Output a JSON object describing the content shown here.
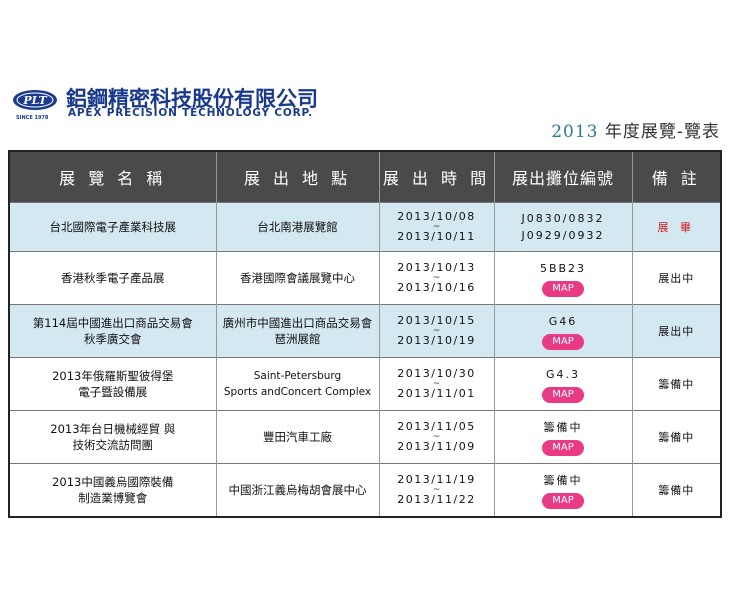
{
  "company": {
    "badge": "PLT",
    "since": "SINCE 1978",
    "name_cn": "鋁鋼精密科技股份有限公司",
    "name_en": "APEX PRECISION TECHNOLOGY CORP."
  },
  "doc_title": {
    "year": "2013",
    "text": "年度展覽-覽表"
  },
  "table": {
    "headers": [
      "展 覽 名 稱",
      "展 出 地 點",
      "展 出 時 間",
      "展出攤位編號",
      "備 註"
    ],
    "rows": [
      {
        "name": [
          "台北國際電子產業科技展"
        ],
        "venue": [
          "台北南港展覽館"
        ],
        "start": "2013/10/08",
        "end": "2013/10/11",
        "booth": [
          "J0830/0832",
          "J0929/0932"
        ],
        "map": "",
        "note": "展 畢",
        "highlight": true
      },
      {
        "name": [
          "香港秋季電子產品展"
        ],
        "venue": [
          "香港國際會議展覽中心"
        ],
        "start": "2013/10/13",
        "end": "2013/10/16",
        "booth": [
          "5BB23"
        ],
        "map": "MAP",
        "note": "展出中",
        "highlight": false
      },
      {
        "name": [
          "第114屆中國進出口商品交易會",
          "秋季廣交會"
        ],
        "venue": [
          "廣州市中國進出口商品交易會",
          "琶洲展館"
        ],
        "start": "2013/10/15",
        "end": "2013/10/19",
        "booth": [
          "G46"
        ],
        "map": "MAP",
        "note": "展出中",
        "highlight": true
      },
      {
        "name": [
          "2013年俄羅斯聖彼得堡",
          "電子暨設備展"
        ],
        "venue": [
          "Saint-Petersburg",
          "Sports andConcert Complex"
        ],
        "start": "2013/10/30",
        "end": "2013/11/01",
        "booth": [
          "G4.3"
        ],
        "map": "MAP",
        "note": "籌備中",
        "highlight": false
      },
      {
        "name": [
          "2013年台日機械經貿 與",
          "技術交流訪問團"
        ],
        "venue": [
          "豐田汽車工廠"
        ],
        "start": "2013/11/05",
        "end": "2013/11/09",
        "booth": [
          "籌備中"
        ],
        "map": "MAP",
        "note": "籌備中",
        "highlight": false
      },
      {
        "name": [
          "2013中國義烏國際裝備",
          "制造業博覽會"
        ],
        "venue": [
          "中國浙江義烏梅胡會展中心"
        ],
        "start": "2013/11/19",
        "end": "2013/11/22",
        "booth": [
          "籌備中"
        ],
        "map": "MAP",
        "note": "籌備中",
        "highlight": false
      }
    ]
  },
  "colors": {
    "brand": "#1a3a8f",
    "header_bg": "#4a4a4a",
    "highlight_row": "#d4e8f2",
    "map_button": "#e83a85",
    "done_text": "#cc2222"
  }
}
